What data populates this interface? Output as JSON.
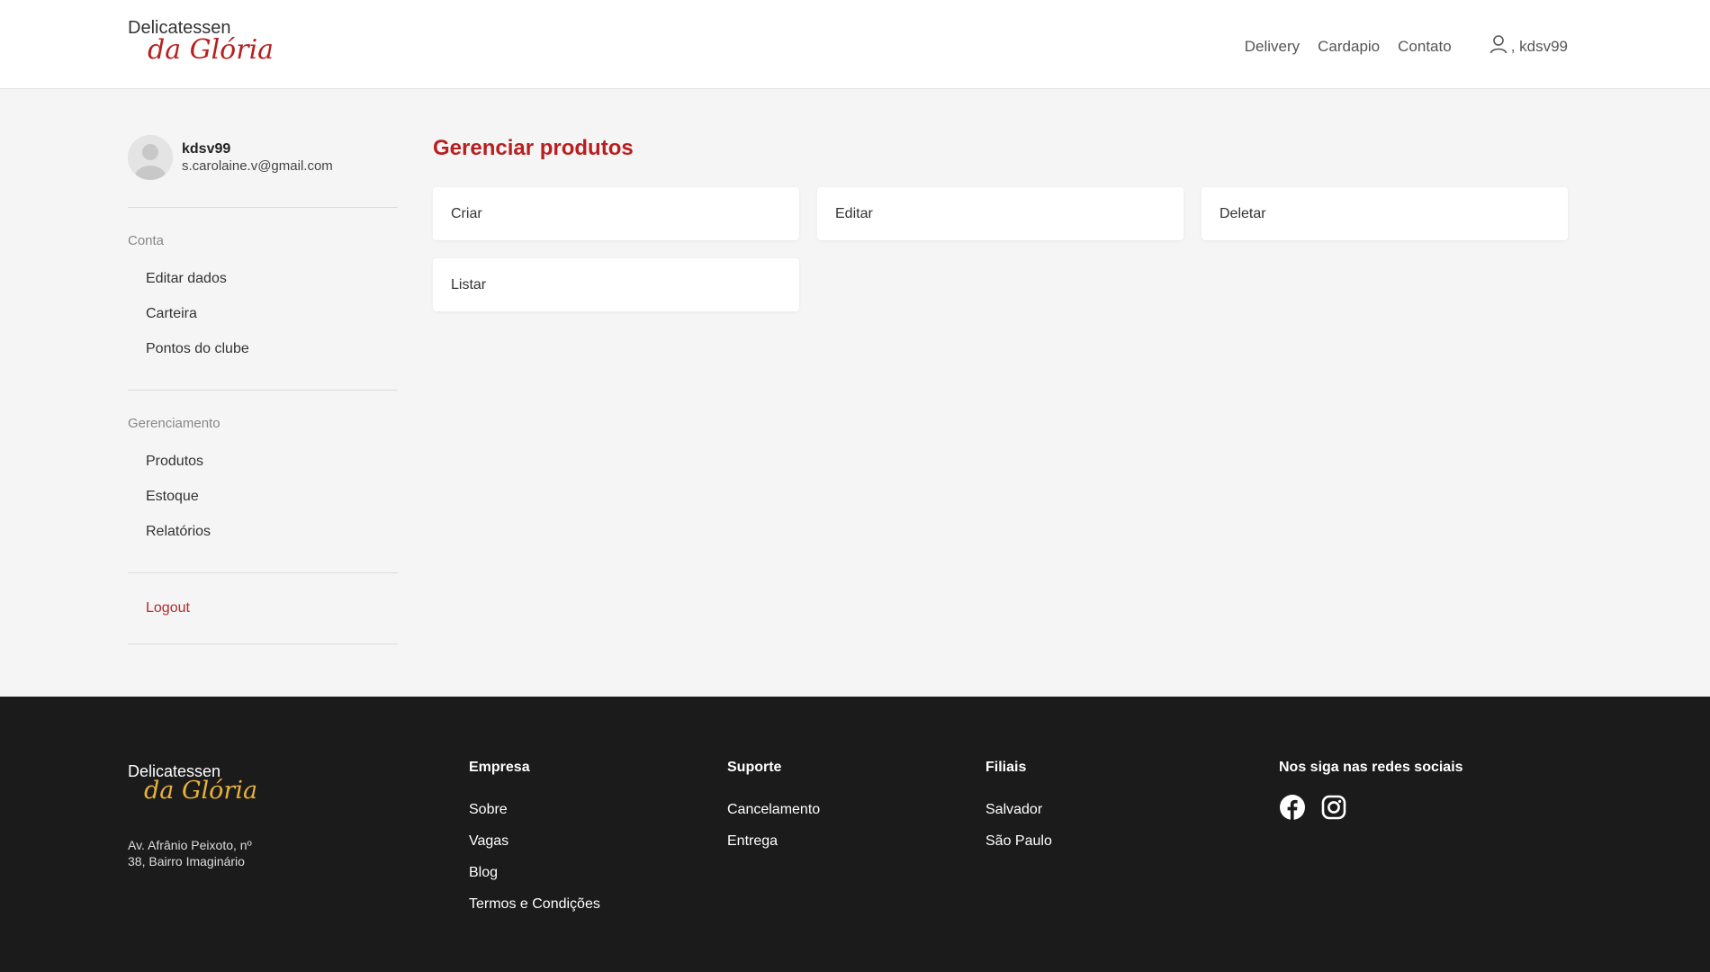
{
  "brand": {
    "name_top": "Delicatessen",
    "name_bottom": "da Glória",
    "accent_color": "#b82020",
    "footer_script_color": "#e8b23a"
  },
  "nav": {
    "links": [
      "Delivery",
      "Cardapio",
      "Contato"
    ],
    "user": ", kdsv99"
  },
  "profile": {
    "username": "kdsv99",
    "email": "s.carolaine.v@gmail.com"
  },
  "sidebar": {
    "account": {
      "label": "Conta",
      "items": [
        "Editar dados",
        "Carteira",
        "Pontos do clube"
      ]
    },
    "management": {
      "label": "Gerenciamento",
      "items": [
        "Produtos",
        "Estoque",
        "Relatórios"
      ]
    },
    "logout": "Logout"
  },
  "main": {
    "title": "Gerenciar produtos",
    "actions": [
      "Criar",
      "Editar",
      "Deletar",
      "Listar"
    ]
  },
  "footer": {
    "address": "Av. Afrânio Peixoto, nº 38, Bairro Imaginário",
    "columns": [
      {
        "title": "Empresa",
        "links": [
          "Sobre",
          "Vagas",
          "Blog",
          "Termos e Condições"
        ]
      },
      {
        "title": "Suporte",
        "links": [
          "Cancelamento",
          "Entrega"
        ]
      },
      {
        "title": "Filiais",
        "links": [
          "Salvador",
          "São Paulo"
        ]
      }
    ],
    "social": {
      "title": "Nos siga nas redes sociais",
      "icons": [
        "facebook-icon",
        "instagram-icon"
      ]
    }
  }
}
